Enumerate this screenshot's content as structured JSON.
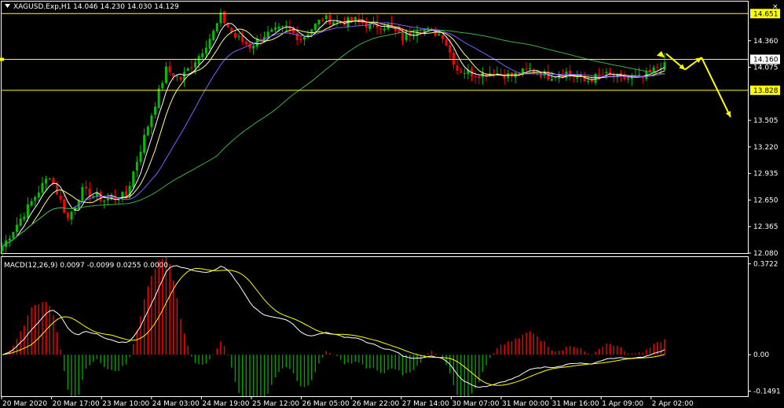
{
  "window": {
    "symbol_title": "XAGUSD.Exp,H1  14.046 14.230 14.030 14.129",
    "close_glyph": "×"
  },
  "colors": {
    "background": "#000000",
    "frame": "#ffffff",
    "bull_candle": "#00c000",
    "bear_candle": "#ff0000",
    "ma_fast": "#ffffff",
    "ma_mid": "#ffff80",
    "ma_slow_violet": "#7f5fff",
    "ma_long": "#3cb043",
    "level_line": "#ffff00",
    "forecast_arrow": "#ffff00",
    "macd_hist_pos": "#ff0000",
    "macd_hist_neg": "#00a000",
    "macd_line": "#ffffff",
    "signal_line": "#ffff00"
  },
  "icons": {
    "triangle": "triangle-down-icon",
    "close": "close-icon"
  },
  "chart_data": [
    {
      "type": "candlestick",
      "name": "XAGUSD.Exp,H1",
      "header": {
        "open": 14.046,
        "high": 14.23,
        "low": 14.03,
        "close": 14.129
      },
      "ylim": [
        12.08,
        14.78
      ],
      "price_ticks": [
        "14.651",
        "14.360",
        "14.075",
        "13.505",
        "13.220",
        "12.935",
        "12.650",
        "12.365",
        "12.080"
      ],
      "highlighted_levels": [
        {
          "value": 14.651,
          "label": "14.651",
          "style": "yellow-box"
        },
        {
          "value": 14.16,
          "label": "14.160",
          "style": "white-box"
        },
        {
          "value": 13.828,
          "label": "13.828",
          "style": "yellow-box"
        }
      ],
      "x_labels": [
        "20 Mar 2020",
        "20 Mar 17:00",
        "23 Mar 10:00",
        "24 Mar 03:00",
        "24 Mar 19:00",
        "25 Mar 12:00",
        "26 Mar 05:00",
        "26 Mar 22:00",
        "27 Mar 14:00",
        "30 Mar 07:00",
        "31 Mar 00:00",
        "31 Mar 16:00",
        "1 Apr 09:00",
        "2 Apr 02:00"
      ],
      "price_anchors": [
        [
          0,
          12.15
        ],
        [
          10,
          12.75
        ],
        [
          13,
          12.92
        ],
        [
          18,
          12.45
        ],
        [
          22,
          12.75
        ],
        [
          28,
          12.65
        ],
        [
          34,
          12.7
        ],
        [
          40,
          13.45
        ],
        [
          45,
          14.05
        ],
        [
          49,
          13.95
        ],
        [
          54,
          14.2
        ],
        [
          58,
          14.45
        ],
        [
          60,
          14.62
        ],
        [
          64,
          14.4
        ],
        [
          68,
          14.3
        ],
        [
          72,
          14.42
        ],
        [
          78,
          14.5
        ],
        [
          82,
          14.38
        ],
        [
          88,
          14.6
        ],
        [
          93,
          14.55
        ],
        [
          97,
          14.58
        ],
        [
          101,
          14.52
        ],
        [
          106,
          14.52
        ],
        [
          110,
          14.38
        ],
        [
          114,
          14.5
        ],
        [
          121,
          14.42
        ],
        [
          125,
          14.05
        ],
        [
          130,
          14.0
        ],
        [
          135,
          14.02
        ],
        [
          140,
          13.98
        ],
        [
          145,
          14.05
        ],
        [
          150,
          13.98
        ],
        [
          155,
          14.02
        ],
        [
          160,
          13.92
        ],
        [
          165,
          14.0
        ],
        [
          170,
          13.95
        ],
        [
          176,
          13.96
        ],
        [
          182,
          14.13
        ]
      ],
      "candle_count": 183,
      "moving_averages": [
        {
          "name": "fast",
          "period": 5,
          "color": "#ffffff"
        },
        {
          "name": "mid",
          "period": 9,
          "color": "#ffff80"
        },
        {
          "name": "slow",
          "period": 20,
          "color": "#7f5fff"
        },
        {
          "name": "long",
          "period": 60,
          "color": "#3cb043"
        }
      ],
      "forecast_path": [
        [
          14.15,
          0
        ],
        [
          14.0,
          1
        ],
        [
          14.12,
          2
        ],
        [
          13.52,
          3
        ]
      ]
    },
    {
      "type": "macd",
      "label": "MACD(12,26,9) 0.0097 -0.0099 0.0255 0.0000",
      "params": {
        "fast": 12,
        "slow": 26,
        "signal": 9
      },
      "values": {
        "macd": 0.0097,
        "signal": -0.0099,
        "hist": 0.0255,
        "extra": 0.0
      },
      "ylim": [
        -0.17,
        0.4
      ],
      "ticks": [
        "0.3722",
        "0.00",
        "-0.1491"
      ]
    }
  ]
}
